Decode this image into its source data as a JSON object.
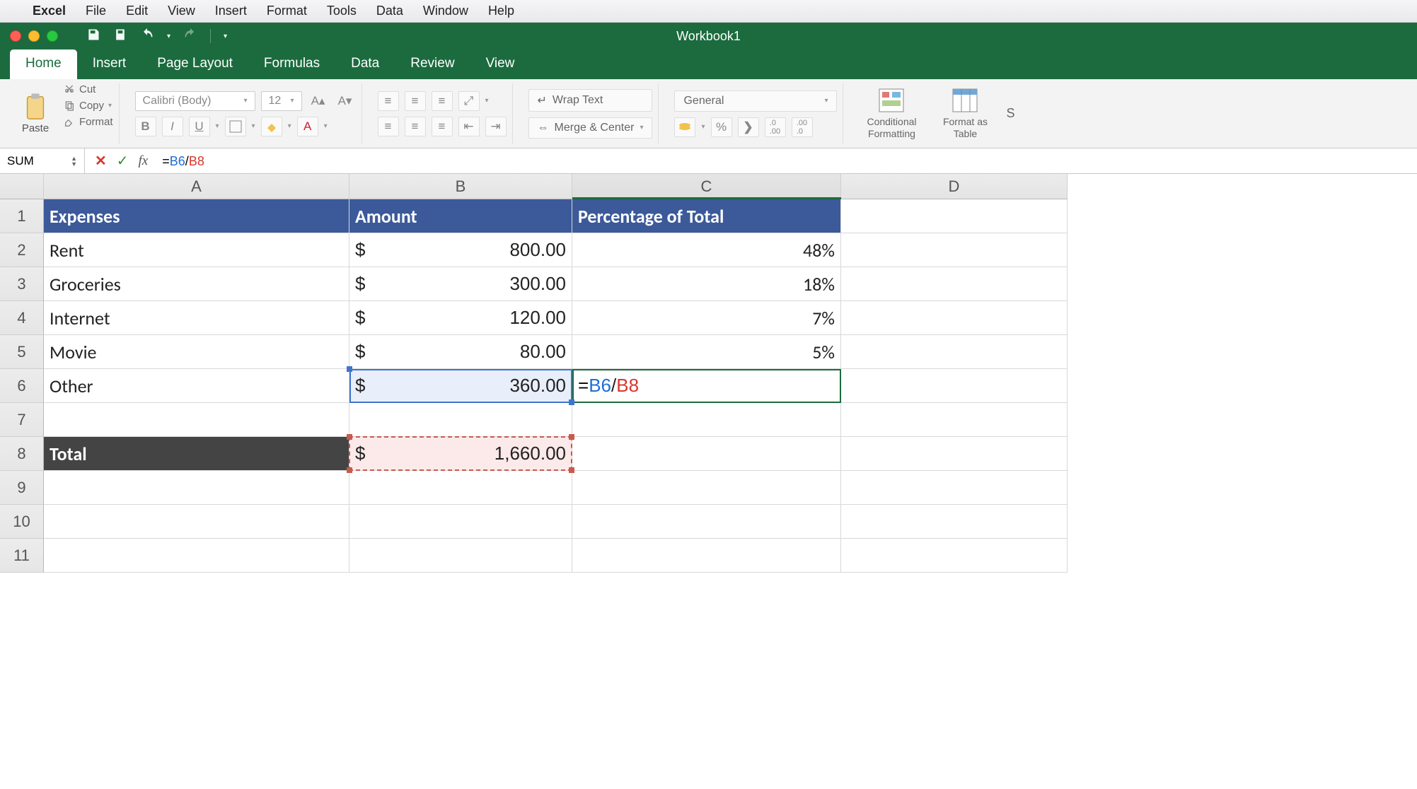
{
  "mac_menu": {
    "app": "Excel",
    "items": [
      "File",
      "Edit",
      "View",
      "Insert",
      "Format",
      "Tools",
      "Data",
      "Window",
      "Help"
    ]
  },
  "titlebar": {
    "document": "Workbook1"
  },
  "ribbon": {
    "tabs": [
      "Home",
      "Insert",
      "Page Layout",
      "Formulas",
      "Data",
      "Review",
      "View"
    ],
    "active_tab": "Home",
    "clipboard": {
      "paste": "Paste",
      "cut": "Cut",
      "copy": "Copy",
      "format": "Format"
    },
    "font": {
      "name": "Calibri (Body)",
      "size": "12"
    },
    "alignment": {
      "wrap": "Wrap Text",
      "merge": "Merge & Center"
    },
    "number": {
      "format": "General",
      "pct": "%"
    },
    "styles": {
      "cond": "Conditional Formatting",
      "table": "Format as Table"
    }
  },
  "formula_bar": {
    "name_box": "SUM",
    "formula": {
      "prefix": "=",
      "ref1": "B6",
      "op": "/",
      "ref2": "B8"
    }
  },
  "columns": [
    "A",
    "B",
    "C",
    "D"
  ],
  "row_numbers": [
    "1",
    "2",
    "3",
    "4",
    "5",
    "6",
    "7",
    "8",
    "9",
    "10",
    "11"
  ],
  "table": {
    "headers": {
      "a": "Expenses",
      "b": "Amount",
      "c": "Percentage of Total"
    },
    "rows": [
      {
        "a": "Rent",
        "b": "800.00",
        "c": "48%"
      },
      {
        "a": "Groceries",
        "b": "300.00",
        "c": "18%"
      },
      {
        "a": "Internet",
        "b": "120.00",
        "c": "7%"
      },
      {
        "a": "Movie",
        "b": "80.00",
        "c": "5%"
      },
      {
        "a": "Other",
        "b": "360.00",
        "c_formula": {
          "prefix": "=",
          "ref1": "B6",
          "op": "/",
          "ref2": "B8"
        }
      }
    ],
    "total": {
      "label": "Total",
      "value": "1,660.00"
    }
  },
  "currency_symbol": "$"
}
